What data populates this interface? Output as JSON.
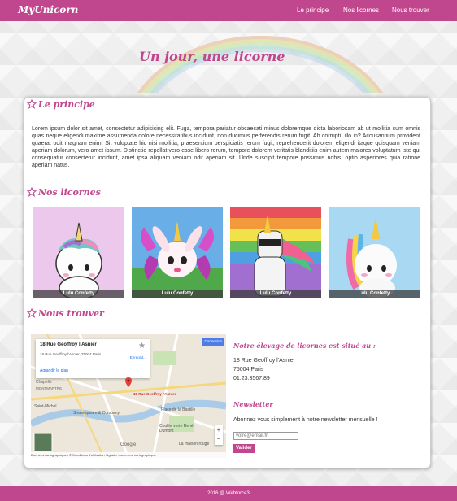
{
  "colors": {
    "brand": "#c0468d",
    "footer": "#c0468d"
  },
  "nav": {
    "brand": "MyUnicorn",
    "links": [
      "Le principe",
      "Nos licornes",
      "Nous trouver"
    ]
  },
  "hero": {
    "title": "Un jour, une licorne"
  },
  "principe": {
    "title": "Le principe",
    "icon": "star-outline-icon",
    "text": "Lorem ipsum dolor sit amet, consectetur adipisicing elit. Fuga, tempora pariatur obcaecati minus doloremque dicta laboriosam ab ut mollitia cum omnis quas neque eligendi maxime assumenda dolore necessitatibus incidunt, non ducimus perferendis rerum fugit. Ab corrupti, illo in? Accusantium provident quaerat odit magnam enim. Sit voluptate hic nisi mollitia, praesentium perspiciatis rerum fugit, reprehenderit dolorem eligendi itaque quisquam veniam aperiam dolorum, vero amet ipsum. Distinctio repellat vero esse libero rerum, tempore dolorem veritatis blanditiis enim autem maiores voluptatum iste qui consequatur consectetur incidunt, amet ipsa aliquam veniam odit aperiam sit. Unde suscipit tempore possimus nobis, optio asperiores quia ratione aperiam natus."
  },
  "licornes": {
    "title": "Nos licornes",
    "icon": "star-outline-icon",
    "items": [
      {
        "caption": "Lulu Confetty"
      },
      {
        "caption": "Lulu Confetty"
      },
      {
        "caption": "Lulu Confetty"
      },
      {
        "caption": "Lulu Confetty"
      }
    ]
  },
  "trouver": {
    "title": "Nous trouver",
    "icon": "star-outline-icon",
    "map": {
      "place_name": "18 Rue Geoffroy l'Asnier",
      "place_address": "18 Rue Geoffroy l'Asnier, 75004 Paris",
      "directions_link": "Agrandir le plan",
      "save_link": "Enregist...",
      "connect_button": "Connexion",
      "pin_label": "18 Rue Geoffroy l'Asnier",
      "labels": [
        "Chapelle",
        "MONTMARTRE",
        "Saint-Michel",
        "Shakespeare & Company",
        "Place de la Bastille",
        "Coulée verte René-Dumont",
        "La maison rouge",
        "Google"
      ],
      "footer": "Données cartographiques ©  Conditions d'utilisation  Signaler une erreur cartographique"
    },
    "location_title": "Notre élevage de licornes est situé au :",
    "address_lines": [
      "18 Rue Geoffroy l'Asnier",
      "75004 Paris",
      "01.23.3567.89"
    ],
    "newsletter_title": "Newsletter",
    "newsletter_text": "Abonnez vous simplement à notre newsletter mensuelle !",
    "email_placeholder": "votre@email.fr",
    "submit_label": "Valider"
  },
  "footer": {
    "text": "2016 @ Webforce3"
  }
}
